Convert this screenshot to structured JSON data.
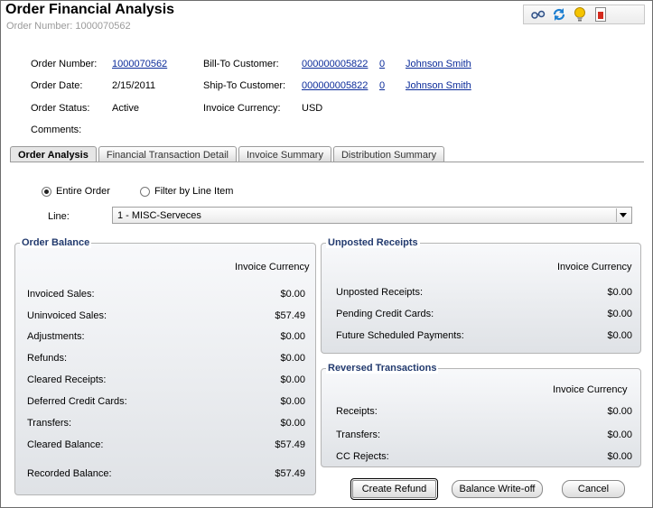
{
  "header": {
    "title": "Order Financial Analysis",
    "subtitle": "Order Number: 1000070562"
  },
  "toolbar": {
    "icons": [
      "glasses-icon",
      "refresh-icon",
      "lightbulb-icon",
      "pdf-report-icon"
    ]
  },
  "order": {
    "number_label": "Order Number:",
    "number_value": "1000070562",
    "date_label": "Order Date:",
    "date_value": "2/15/2011",
    "status_label": "Order Status:",
    "status_value": "Active",
    "comments_label": "Comments:",
    "bill_to_label": "Bill-To Customer:",
    "bill_to_id": "000000005822",
    "bill_to_num": "0",
    "bill_to_name": "Johnson Smith",
    "ship_to_label": "Ship-To Customer:",
    "ship_to_id": "000000005822",
    "ship_to_num": "0",
    "ship_to_name": "Johnson Smith",
    "currency_label": "Invoice Currency:",
    "currency_value": "USD"
  },
  "tabs": [
    {
      "label": "Order Analysis",
      "active": true
    },
    {
      "label": "Financial Transaction Detail",
      "active": false
    },
    {
      "label": "Invoice Summary",
      "active": false
    },
    {
      "label": "Distribution Summary",
      "active": false
    }
  ],
  "filter": {
    "entire_order": "Entire Order",
    "by_line": "Filter by Line Item",
    "selected": "entire_order",
    "line_label": "Line:",
    "line_value": "1 - MISC-Serveces"
  },
  "order_balance": {
    "title": "Order Balance",
    "column": "Invoice Currency",
    "rows": [
      {
        "label": "Invoiced Sales:",
        "value": "$0.00"
      },
      {
        "label": "Uninvoiced Sales:",
        "value": "$57.49"
      },
      {
        "label": "Adjustments:",
        "value": "$0.00"
      },
      {
        "label": "Refunds:",
        "value": "$0.00"
      },
      {
        "label": "Cleared Receipts:",
        "value": "$0.00"
      },
      {
        "label": "Deferred Credit Cards:",
        "value": "$0.00"
      },
      {
        "label": "Transfers:",
        "value": "$0.00"
      },
      {
        "label": "Cleared Balance:",
        "value": "$57.49"
      },
      {
        "label": "Recorded Balance:",
        "value": "$57.49"
      }
    ]
  },
  "unposted": {
    "title": "Unposted Receipts",
    "column": "Invoice Currency",
    "rows": [
      {
        "label": "Unposted Receipts:",
        "value": "$0.00"
      },
      {
        "label": "Pending Credit Cards:",
        "value": "$0.00"
      },
      {
        "label": "Future Scheduled Payments:",
        "value": "$0.00"
      }
    ]
  },
  "reversed": {
    "title": "Reversed Transactions",
    "column": "Invoice Currency",
    "rows": [
      {
        "label": "Receipts:",
        "value": "$0.00"
      },
      {
        "label": "Transfers:",
        "value": "$0.00"
      },
      {
        "label": "CC Rejects:",
        "value": "$0.00"
      }
    ]
  },
  "buttons": {
    "create_refund": "Create Refund",
    "balance_writeoff": "Balance Write-off",
    "cancel": "Cancel"
  }
}
